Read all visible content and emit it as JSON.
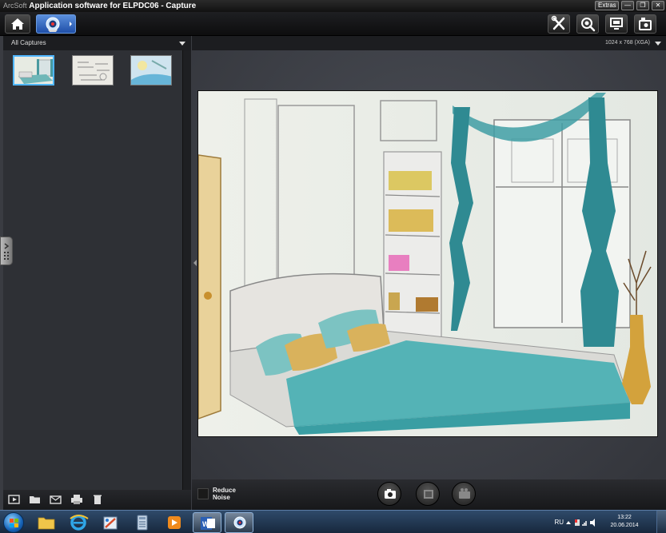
{
  "window": {
    "brand": "ArcSoft",
    "title": "Application software for ELPDC06 - Capture",
    "extras_label": "Extras",
    "min_label": "—",
    "max_label": "❐",
    "close_label": "✕"
  },
  "left_panel": {
    "filter_label": "All Captures",
    "thumbnails": [
      {
        "name": "capture-1",
        "selected": true
      },
      {
        "name": "capture-2",
        "selected": false
      },
      {
        "name": "capture-3",
        "selected": false
      }
    ]
  },
  "preview": {
    "resolution_label": "1024 x 768 (XGA)"
  },
  "capture_bar": {
    "noise_label_line1": "Reduce",
    "noise_label_line2": "Noise"
  },
  "taskbar": {
    "language": "RU",
    "time": "13:22",
    "date": "20.06.2014"
  },
  "colors": {
    "accent": "#4fb6ff",
    "toolbar_bg": "#0d0d0e",
    "panel_bg": "#35373c"
  }
}
